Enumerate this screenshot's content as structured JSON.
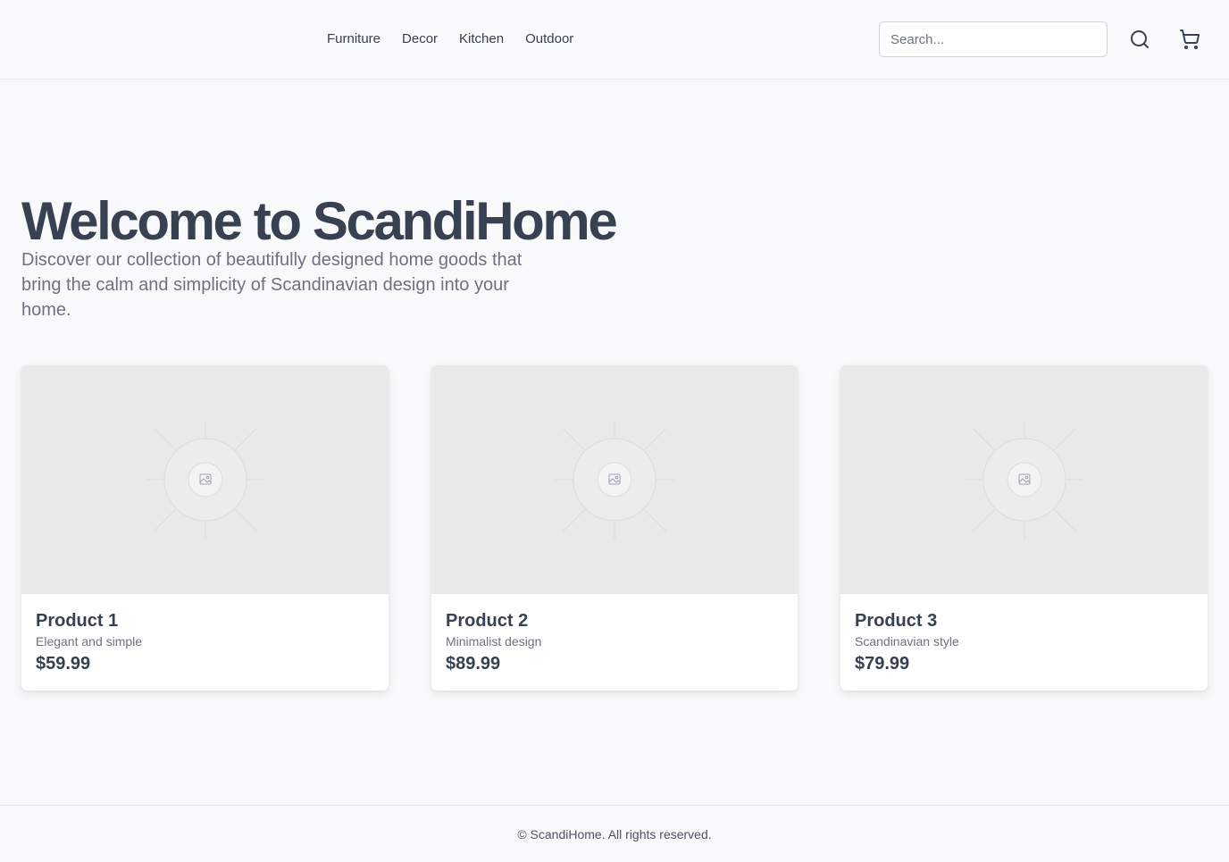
{
  "nav": {
    "items": [
      "Furniture",
      "Decor",
      "Kitchen",
      "Outdoor"
    ]
  },
  "search": {
    "placeholder": "Search..."
  },
  "icons": {
    "search": "search-icon",
    "cart": "cart-icon",
    "image_placeholder": "image-placeholder-icon"
  },
  "hero": {
    "title": "Welcome to ScandiHome",
    "subtitle": "Discover our collection of beautifully designed home goods that bring the calm and simplicity of Scandinavian design into your home."
  },
  "products": [
    {
      "name": "Product 1",
      "description": "Elegant and simple",
      "price": "$59.99"
    },
    {
      "name": "Product 2",
      "description": "Minimalist design",
      "price": "$89.99"
    },
    {
      "name": "Product 3",
      "description": "Scandinavian style",
      "price": "$79.99"
    }
  ],
  "footer": {
    "text": "© ScandiHome. All rights reserved."
  },
  "colors": {
    "background": "#f8f9fa",
    "text": "#374151",
    "muted": "#6b7280",
    "image_placeholder": "#e9e9e9"
  }
}
